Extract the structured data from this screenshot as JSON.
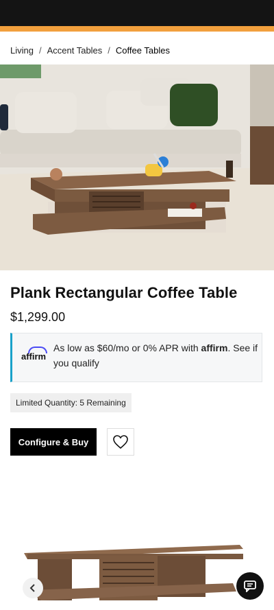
{
  "breadcrumb": {
    "items": [
      "Living",
      "Accent Tables",
      "Coffee Tables"
    ],
    "separator": "/"
  },
  "product": {
    "title": "Plank Rectangular Coffee Table",
    "price": "$1,299.00"
  },
  "financing": {
    "logo_text": "affirm",
    "text_before": "As low as $60/mo or 0% APR with ",
    "brand": "affirm",
    "text_after": ". See if you qualify"
  },
  "stock_badge": "Limited Quantity: 5 Remaining",
  "actions": {
    "configure_label": "Configure & Buy",
    "wishlist_icon": "heart-icon"
  },
  "carousel": {
    "prev_icon": "chevron-left-icon"
  },
  "chat": {
    "icon": "chat-icon"
  },
  "colors": {
    "promo_bar": "#f2a03d",
    "affirm_accent": "#1aa1c9",
    "button_bg": "#000000"
  }
}
